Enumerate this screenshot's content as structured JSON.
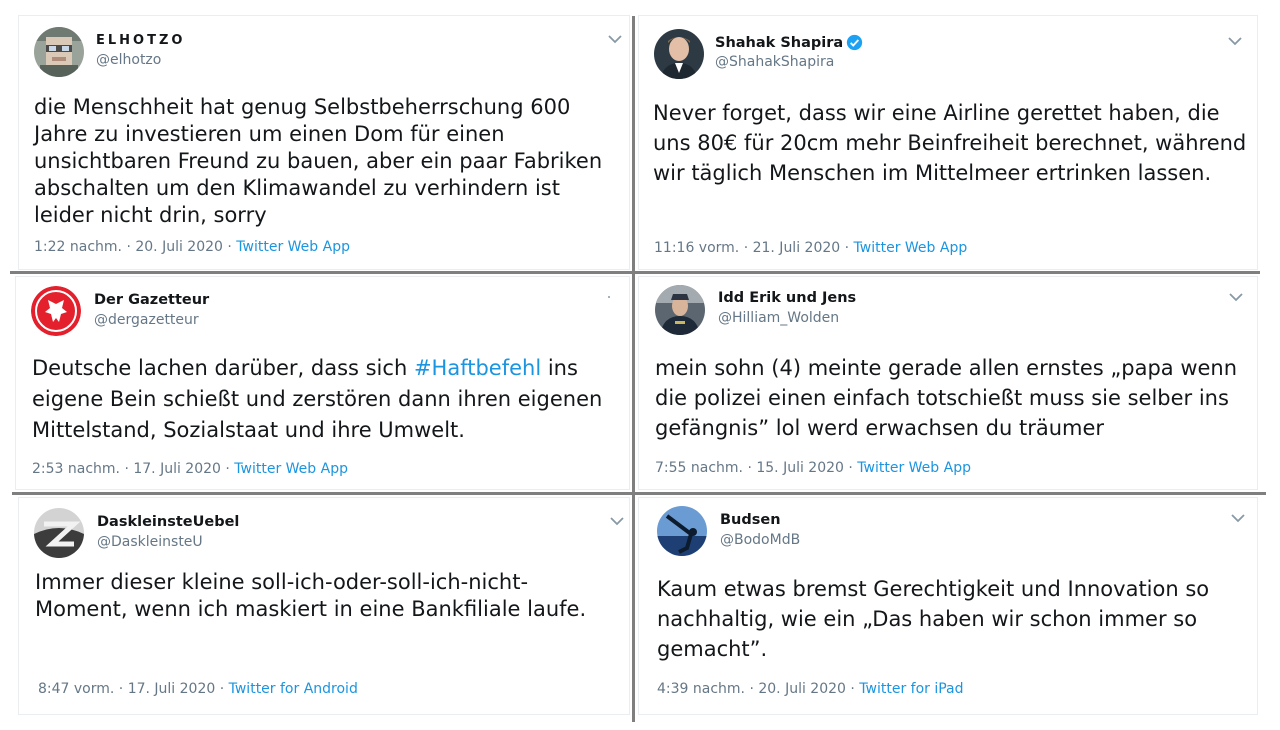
{
  "tweets": [
    {
      "name": "ELHOTZO",
      "handle": "@elhotzo",
      "text": "die Menschheit hat genug Selbstbeherrschung 600 Jahre zu investieren um einen Dom für einen unsichtbaren Freund zu bauen, aber ein paar Fabriken abschalten um den Klimawandel zu verhindern ist leider nicht drin, sorry",
      "timestamp": "1:22 nachm. · 20. Juli 2020 · ",
      "source": "Twitter Web App",
      "verified": false,
      "avatar_icon": "pixelated-face-avatar"
    },
    {
      "name": "Shahak Shapira",
      "handle": "@ShahakShapira",
      "text": "Never forget, dass wir eine Airline gerettet haben, die uns 80€ für 20cm mehr Beinfreiheit berechnet, während wir täglich Menschen im Mittelmeer ertrinken lassen.",
      "timestamp": "11:16 vorm. · 21. Juli 2020 · ",
      "source": "Twitter Web App",
      "verified": true,
      "avatar_icon": "man-in-suit-avatar"
    },
    {
      "name": "Der Gazetteur",
      "handle": "@dergazetteur",
      "text_before": "Deutsche lachen darüber, dass sich ",
      "hashtag": "#Haftbefehl",
      "text_after": " ins eigene Bein schießt und zerstören dann ihren eigenen Mittelstand, Sozialstaat und ihre Umwelt.",
      "timestamp": "2:53 nachm. · 17. Juli 2020 · ",
      "source": "Twitter Web App",
      "verified": false,
      "avatar_icon": "red-eagle-crest-avatar"
    },
    {
      "name": "Idd Erik und Jens",
      "handle": "@Hilliam_Wolden",
      "text": "mein sohn (4) meinte gerade allen ernstes „papa wenn die polizei einen einfach totschießt muss sie selber ins gefängnis” lol werd erwachsen du träumer",
      "timestamp": "7:55 nachm. · 15. Juli 2020 · ",
      "source": "Twitter Web App",
      "verified": false,
      "avatar_icon": "police-officer-avatar"
    },
    {
      "name": "DaskleinsteUebel",
      "handle": "@DaskleinsteU",
      "text": "Immer dieser kleine soll-ich-oder-soll-ich-nicht-Moment, wenn ich maskiert in eine Bankfiliale laufe.",
      "timestamp": "8:47 vorm. · 17. Juli 2020 · ",
      "source": "Twitter for Android",
      "verified": false,
      "avatar_icon": "grey-z-logo-avatar"
    },
    {
      "name": "Budsen",
      "handle": "@BodoMdB",
      "text": "Kaum etwas bremst Gerechtigkeit und Innovation so nachhaltig, wie ein „Das haben wir schon immer so gemacht”.",
      "timestamp": "4:39 nachm. · 20. Juli 2020 · ",
      "source": "Twitter for iPad",
      "verified": false,
      "avatar_icon": "blue-sky-avatar"
    }
  ],
  "colors": {
    "text": "#14171a",
    "secondary": "#657786",
    "link": "#1b95e0",
    "verified": "#1da1f2",
    "divider": "#7f7f7f"
  }
}
